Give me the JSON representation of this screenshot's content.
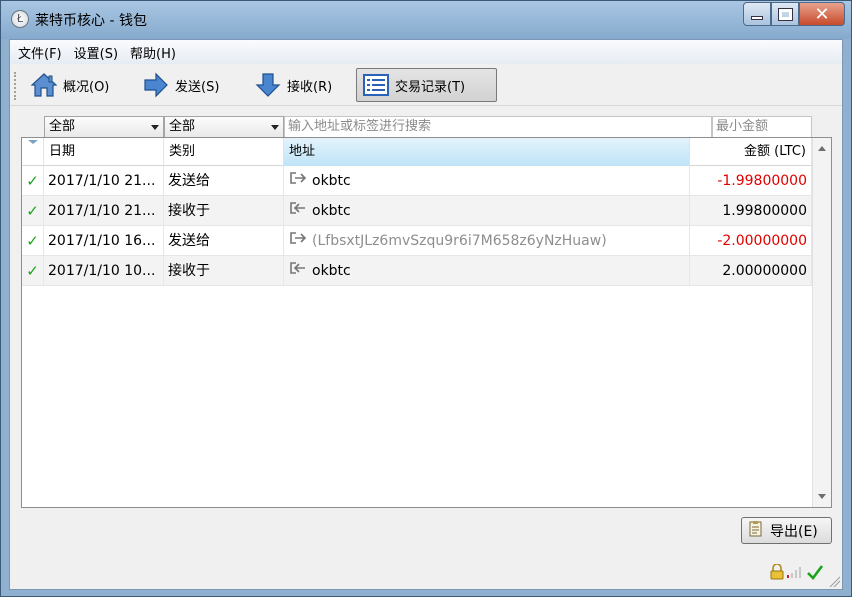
{
  "window": {
    "title": "莱特币核心 - 钱包"
  },
  "menu": [
    {
      "label": "文件(F)"
    },
    {
      "label": "设置(S)"
    },
    {
      "label": "帮助(H)"
    }
  ],
  "toolbar": {
    "overview": "概况(O)",
    "send": "发送(S)",
    "receive": "接收(R)",
    "transactions": "交易记录(T)"
  },
  "filters": {
    "date_combo": "全部",
    "type_combo": "全部",
    "search_placeholder": "输入地址或标签进行搜索",
    "min_amount_placeholder": "最小金额"
  },
  "table": {
    "headers": {
      "date": "日期",
      "type": "类别",
      "address": "地址",
      "amount": "金额 (LTC)"
    },
    "rows": [
      {
        "date": "2017/1/10 21...",
        "type": "发送给",
        "address": "okbtc",
        "amount": "-1.99800000"
      },
      {
        "date": "2017/1/10 21...",
        "type": "接收于",
        "address": "okbtc",
        "amount": "1.99800000"
      },
      {
        "date": "2017/1/10 16...",
        "type": "发送给",
        "address": "(LfbsxtJLz6mvSzqu9r6i7M658z6yNzHuaw)",
        "amount": "-2.00000000"
      },
      {
        "date": "2017/1/10 10...",
        "type": "接收于",
        "address": "okbtc",
        "amount": "2.00000000"
      }
    ]
  },
  "export_button": "导出(E)",
  "colors": {
    "negative": "#e00000",
    "confirmed": "#1aa51a",
    "selected_header": "#bfe4f7"
  }
}
